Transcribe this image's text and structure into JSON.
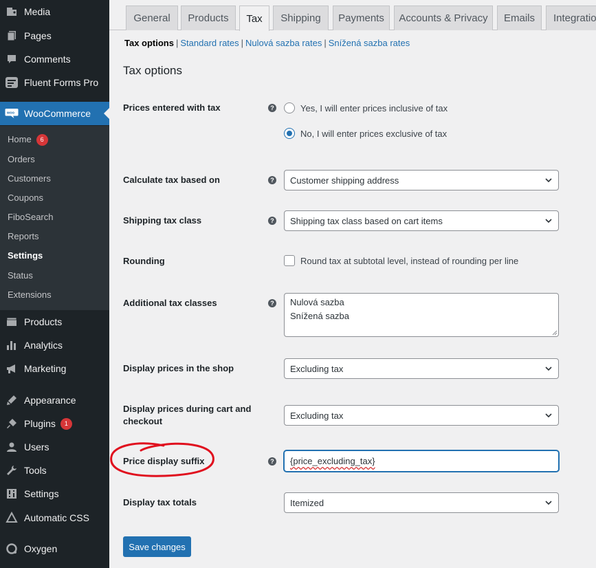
{
  "sidebar": {
    "top_items": [
      {
        "label": "Media",
        "icon": "media-icon"
      },
      {
        "label": "Pages",
        "icon": "pages-icon"
      },
      {
        "label": "Comments",
        "icon": "comments-icon"
      },
      {
        "label": "Fluent Forms Pro",
        "icon": "fluent-forms-icon"
      },
      {
        "label": "WooCommerce",
        "icon": "woocommerce-icon"
      }
    ],
    "submenu": [
      {
        "label": "Home",
        "badge": "6"
      },
      {
        "label": "Orders"
      },
      {
        "label": "Customers"
      },
      {
        "label": "Coupons"
      },
      {
        "label": "FiboSearch"
      },
      {
        "label": "Reports"
      },
      {
        "label": "Settings"
      },
      {
        "label": "Status"
      },
      {
        "label": "Extensions"
      }
    ],
    "bottom_items": [
      {
        "label": "Products",
        "icon": "products-icon"
      },
      {
        "label": "Analytics",
        "icon": "analytics-icon"
      },
      {
        "label": "Marketing",
        "icon": "marketing-icon"
      },
      {
        "label": "Appearance",
        "icon": "appearance-icon"
      },
      {
        "label": "Plugins",
        "icon": "plugins-icon",
        "badge": "1"
      },
      {
        "label": "Users",
        "icon": "users-icon"
      },
      {
        "label": "Tools",
        "icon": "tools-icon"
      },
      {
        "label": "Settings",
        "icon": "settings-icon"
      },
      {
        "label": "Automatic CSS",
        "icon": "automatic-css-icon"
      },
      {
        "label": "Oxygen",
        "icon": "oxygen-icon"
      }
    ]
  },
  "tabs": [
    "General",
    "Products",
    "Tax",
    "Shipping",
    "Payments",
    "Accounts & Privacy",
    "Emails",
    "Integration"
  ],
  "subsub": {
    "current": "Tax options",
    "links": [
      "Standard rates",
      "Nulová sazba rates",
      "Snížená sazba rates"
    ]
  },
  "section_title": "Tax options",
  "fields": {
    "prices_entered": {
      "label": "Prices entered with tax",
      "option_inclusive": "Yes, I will enter prices inclusive of tax",
      "option_exclusive": "No, I will enter prices exclusive of tax",
      "selected": "exclusive"
    },
    "calc_based_on": {
      "label": "Calculate tax based on",
      "value": "Customer shipping address"
    },
    "shipping_class": {
      "label": "Shipping tax class",
      "value": "Shipping tax class based on cart items"
    },
    "rounding": {
      "label": "Rounding",
      "checkbox_label": "Round tax at subtotal level, instead of rounding per line",
      "checked": false
    },
    "additional_classes": {
      "label": "Additional tax classes",
      "line1": "Nulová sazba",
      "line2": "Snížená sazba"
    },
    "display_shop": {
      "label": "Display prices in the shop",
      "value": "Excluding tax"
    },
    "display_cart": {
      "label_line1": "Display prices during cart and",
      "label_line2": "checkout",
      "value": "Excluding tax"
    },
    "price_suffix": {
      "label": "Price display suffix",
      "value": "{price_excluding_tax}"
    },
    "display_totals": {
      "label": "Display tax totals",
      "value": "Itemized"
    }
  },
  "save_label": "Save changes",
  "colors": {
    "accent": "#2271b1",
    "sidebar_bg": "#1d2327",
    "annotation": "#e0101e",
    "badge": "#d63638"
  }
}
